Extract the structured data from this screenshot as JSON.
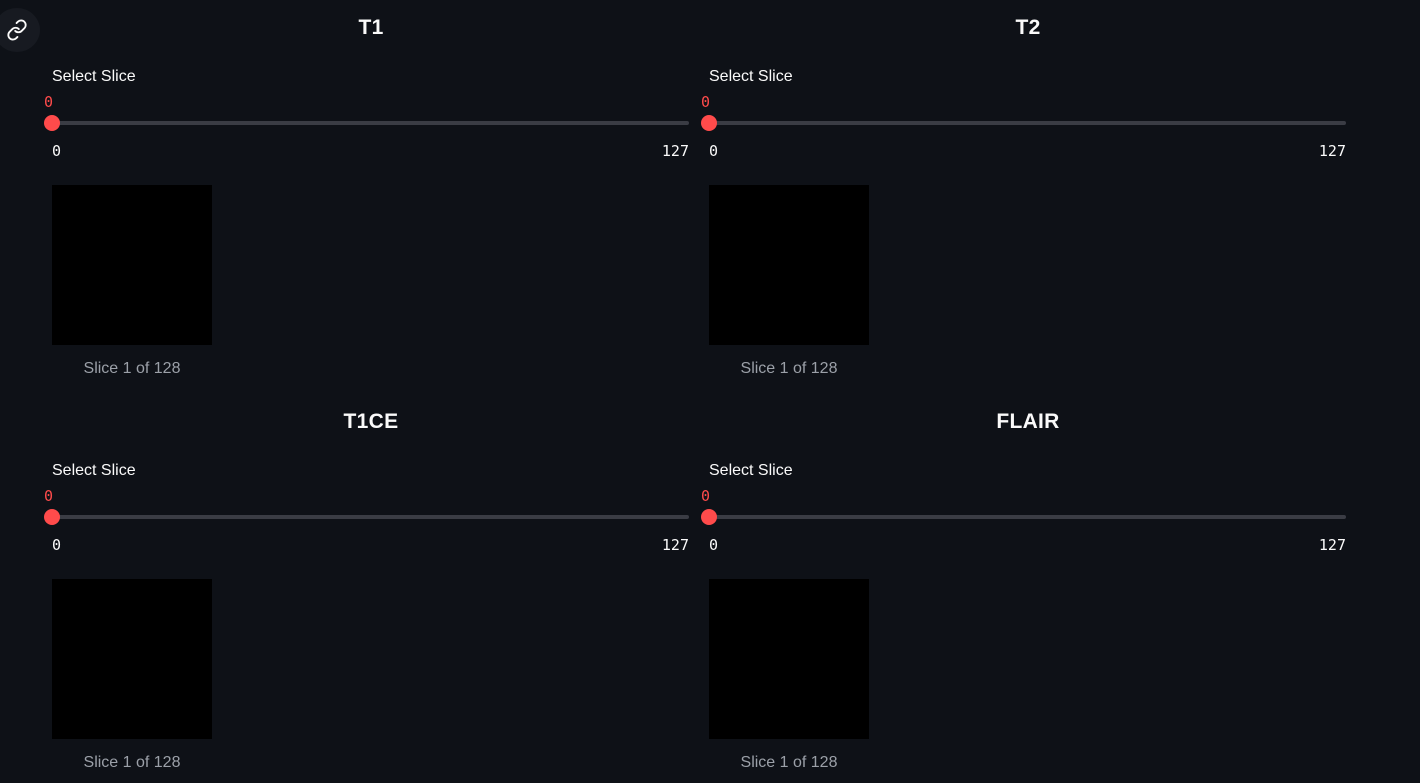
{
  "colors": {
    "background": "#0e1117",
    "accent": "#ff4b4b",
    "track": "#3a3c44",
    "caption": "#9ba0a8"
  },
  "header": {
    "link_icon": "link-icon"
  },
  "panels": [
    {
      "title": "T1",
      "slider": {
        "label": "Select Slice",
        "value": "0",
        "min": "0",
        "max": "127",
        "fraction": 0
      },
      "caption": "Slice 1 of 128"
    },
    {
      "title": "T2",
      "slider": {
        "label": "Select Slice",
        "value": "0",
        "min": "0",
        "max": "127",
        "fraction": 0
      },
      "caption": "Slice 1 of 128"
    },
    {
      "title": "T1CE",
      "slider": {
        "label": "Select Slice",
        "value": "0",
        "min": "0",
        "max": "127",
        "fraction": 0
      },
      "caption": "Slice 1 of 128"
    },
    {
      "title": "FLAIR",
      "slider": {
        "label": "Select Slice",
        "value": "0",
        "min": "0",
        "max": "127",
        "fraction": 0
      },
      "caption": "Slice 1 of 128"
    }
  ]
}
